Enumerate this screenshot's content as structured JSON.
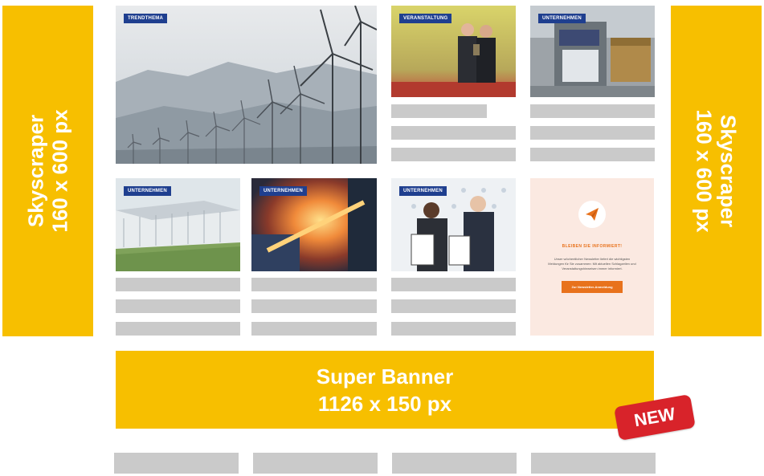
{
  "skyscraper_left": {
    "line1": "Skyscraper",
    "line2": "160 x 600 px"
  },
  "skyscraper_right": {
    "line1": "Skyscraper",
    "line2": "160 x 600 px"
  },
  "tiles": [
    {
      "tag": "TRENDTHEMA"
    },
    {
      "tag": "VERANSTALTUNG"
    },
    {
      "tag": "UNTERNEHMEN"
    },
    {
      "tag": "UNTERNEHMEN"
    },
    {
      "tag": "UNTERNEHMEN"
    },
    {
      "tag": "UNTERNEHMEN"
    }
  ],
  "newsletter": {
    "title": "BLEIBEN SIE INFORMIERT!",
    "body": "Unser wöchentlicher Newsletter liefert die wichtigsten Meldungen für Sie zusammen: Mit aktuellen Schlagzeilen und Veranstaltungshinweisen immer informiert.",
    "button": "Zur Newsletter-Anmeldung"
  },
  "super_banner": {
    "line1": "Super Banner",
    "line2": "1126 x 150 px"
  },
  "badge": "NEW",
  "colors": {
    "ad_yellow": "#f7bf00",
    "placeholder_gray": "#cacaca",
    "badge_red": "#d8232a",
    "tag_blue": "#1f3f8f",
    "newsletter_orange": "#e8721c"
  }
}
